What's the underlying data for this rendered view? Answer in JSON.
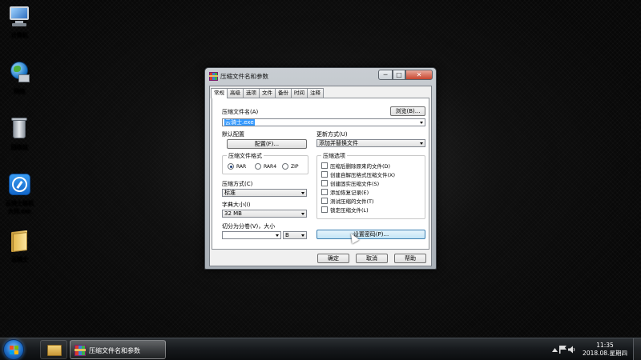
{
  "desktop": {
    "icons": [
      {
        "label": "计算机",
        "icon": "computer-icon"
      },
      {
        "label": "网络",
        "icon": "network-icon"
      },
      {
        "label": "回收站",
        "icon": "recycle-bin-icon"
      },
      {
        "label": "云骑士装机",
        "label2": "大师.exe",
        "icon": "yunqishi-app-icon"
      },
      {
        "label": "云骑士",
        "icon": "folder-icon"
      }
    ]
  },
  "dialog": {
    "title": "压缩文件名和参数",
    "controls": {
      "minimize": "─",
      "maximize": "□",
      "close": "✕"
    },
    "tabs": [
      "常规",
      "高级",
      "选项",
      "文件",
      "备份",
      "时间",
      "注释"
    ],
    "active_tab": "常规",
    "archive_name_label": "压缩文件名(A)",
    "archive_name_value": "云骑士.exe",
    "browse_button": "浏览(B)...",
    "default_config_label": "默认配置",
    "profiles_button": "配置(F)...",
    "update_mode_label": "更新方式(U)",
    "update_mode_value": "添加并替换文件",
    "format_group": "压缩文件格式",
    "formats": [
      "RAR",
      "RAR4",
      "ZIP"
    ],
    "selected_format": "RAR",
    "method_label": "压缩方式(C)",
    "method_value": "标准",
    "dict_label": "字典大小(I)",
    "dict_value": "32 MB",
    "split_label": "切分为分卷(V)，大小",
    "split_value": "",
    "split_unit": "B",
    "options_group": "压缩选项",
    "options": [
      {
        "label": "压缩后删除原来的文件(D)",
        "checked": false
      },
      {
        "label": "创建自解压格式压缩文件(X)",
        "checked": false
      },
      {
        "label": "创建固实压缩文件(S)",
        "checked": false
      },
      {
        "label": "添加恢复记录(E)",
        "checked": false
      },
      {
        "label": "测试压缩的文件(T)",
        "checked": false
      },
      {
        "label": "锁定压缩文件(L)",
        "checked": false
      }
    ],
    "set_password_button": "设置密码(P)...",
    "ok_button": "确定",
    "cancel_button": "取消",
    "help_button": "帮助"
  },
  "taskbar": {
    "active_window": "压缩文件名和参数",
    "time": "11:35",
    "date": "2018.08.星期四"
  }
}
